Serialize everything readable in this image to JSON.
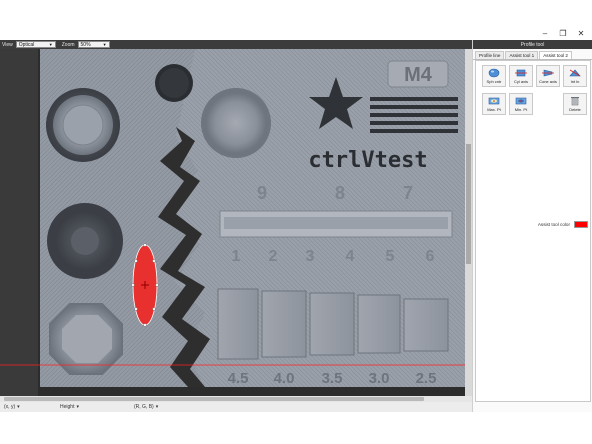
{
  "window": {
    "title": "Profile tool",
    "controls": [
      "minimize",
      "maximize",
      "close"
    ]
  },
  "toolbar": {
    "view_label": "View",
    "view_value": "Optical",
    "zoom_label": "Zoom",
    "zoom_value": "50%"
  },
  "statusbar": {
    "coord_value": "(x, y)",
    "height_value": "Height",
    "rgb_value": "(R, G, B)"
  },
  "panel": {
    "title": "Profile tool",
    "tabs": [
      {
        "label": "Profile line",
        "active": false
      },
      {
        "label": "Assist tool 1",
        "active": false
      },
      {
        "label": "Assist tool 2",
        "active": true
      }
    ],
    "tools": [
      {
        "label": "Sph cntr",
        "icon": "sphere-icon"
      },
      {
        "label": "Cyl axis",
        "icon": "cylinder-axis-icon"
      },
      {
        "label": "Cone axis",
        "icon": "cone-axis-icon"
      },
      {
        "label": "Int ln",
        "icon": "intersection-line-icon"
      },
      {
        "label": "Max. Pt",
        "icon": "max-point-icon"
      },
      {
        "label": "Min. Pt",
        "icon": "min-point-icon"
      },
      {
        "label": "Delete",
        "icon": "delete-icon"
      }
    ],
    "color_label": "Assist tool color",
    "color_value": "#ff0000"
  },
  "part": {
    "badge": "M4",
    "logo": "ctrlVtest",
    "digits_top": [
      "9",
      "8",
      "7"
    ],
    "digits_mid": [
      "1",
      "2",
      "3",
      "4",
      "5",
      "6"
    ],
    "digits_bottom": [
      "4.5",
      "4.0",
      "3.5",
      "3.0",
      "2.5"
    ]
  },
  "colors": {
    "background_dark": "#2a2a2a",
    "plate": "#8d939d",
    "plate_light": "#a9aeb7",
    "accent_red": "#e8302e",
    "profile_line": "#ff2020"
  }
}
